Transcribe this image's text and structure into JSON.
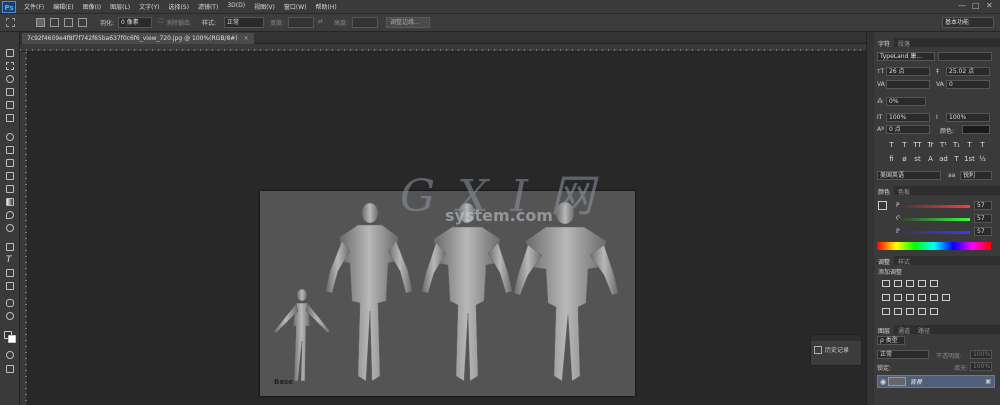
{
  "app": {
    "logo": "Ps"
  },
  "menubar": {
    "items": [
      "文件(F)",
      "编辑(E)",
      "图像(I)",
      "图层(L)",
      "文字(Y)",
      "选择(S)",
      "滤镜(T)",
      "3D(D)",
      "视图(V)",
      "窗口(W)",
      "帮助(H)"
    ],
    "window_controls": [
      "—",
      "□",
      "✕"
    ]
  },
  "options": {
    "feather_label": "羽化:",
    "feather_value": "0 像素",
    "antialias_label": "消除锯齿",
    "style_label": "样式:",
    "style_value": "正常",
    "width_label": "宽度:",
    "height_label": "高度:",
    "refine_edge": "调整边缘...",
    "workspace": "基本功能"
  },
  "document": {
    "tab_title": "7c92f4609e4f8f7f742f65ba637f0c6f6_view_720.jpg @ 100%(RGB/8#)",
    "tab_close": "×",
    "canvas_label": "Base"
  },
  "watermark": {
    "main": "G X I 网",
    "sub": "system.com"
  },
  "history_panel": {
    "label": "历史记录"
  },
  "character_panel": {
    "tabs": [
      "字符",
      "段落"
    ],
    "font_family": "TypeLand 康...",
    "font_size": "26 点",
    "leading": "25.02 点",
    "kerning_label": "VA",
    "tracking": "0",
    "vertical_scale_pct": "0%",
    "scale_v": "100%",
    "scale_h": "100%",
    "baseline": "0 点",
    "color_label": "颜色:",
    "glyph_row1": [
      "T",
      "T",
      "TT",
      "Tr",
      "T¹",
      "T₁",
      "T",
      "T"
    ],
    "glyph_row2": [
      "fi",
      "ø",
      "st",
      "A",
      "ad",
      "T",
      "1st",
      "½"
    ],
    "language": "美国英语",
    "antialias": "锐利"
  },
  "color_panel": {
    "tabs": [
      "颜色",
      "色板"
    ],
    "r_label": "R",
    "r_value": "57",
    "g_label": "G",
    "g_value": "57",
    "b_label": "B",
    "b_value": "57"
  },
  "adjustments_panel": {
    "tabs": [
      "调整",
      "样式"
    ],
    "title": "添加调整"
  },
  "layers_panel": {
    "tabs": [
      "图层",
      "通道",
      "路径"
    ],
    "filter": "ρ 类型",
    "blend_mode": "正常",
    "opacity_label": "不透明度:",
    "opacity_value": "100%",
    "lock_label": "锁定:",
    "fill_label": "填充:",
    "fill_value": "100%",
    "layer_name": "背景"
  }
}
